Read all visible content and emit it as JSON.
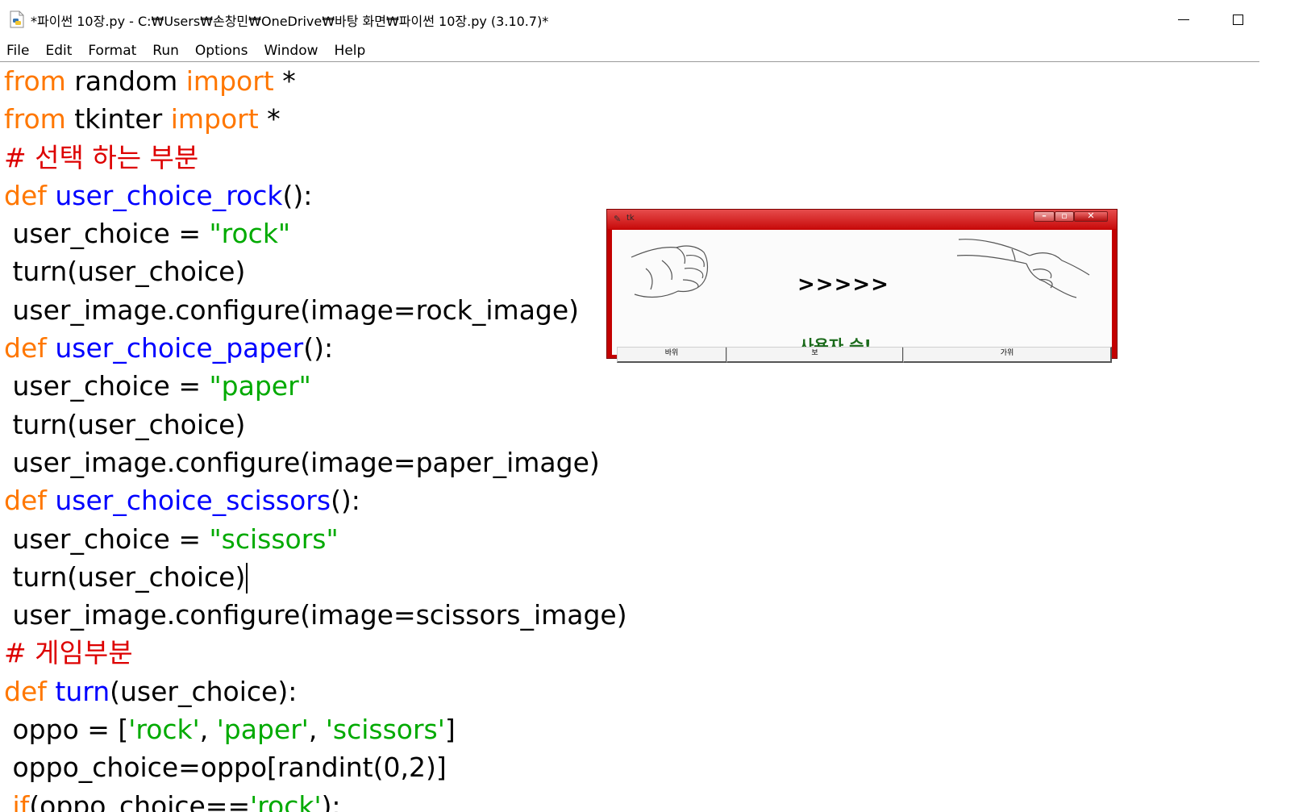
{
  "window": {
    "title": "*파이썬 10장.py - C:₩Users₩손창민₩OneDrive₩바탕 화면₩파이썬 10장.py (3.10.7)*"
  },
  "menu": {
    "items": [
      "File",
      "Edit",
      "Format",
      "Run",
      "Options",
      "Window",
      "Help"
    ]
  },
  "code": {
    "lines": [
      [
        [
          "kw",
          "from"
        ],
        [
          "pl",
          " random "
        ],
        [
          "kw",
          "import"
        ],
        [
          "pl",
          " *"
        ]
      ],
      [
        [
          "kw",
          "from"
        ],
        [
          "pl",
          " tkinter "
        ],
        [
          "kw",
          "import"
        ],
        [
          "pl",
          " *"
        ]
      ],
      [
        [
          "com",
          "# 선택 하는 부분"
        ]
      ],
      [
        [
          "kw",
          "def"
        ],
        [
          "pl",
          " "
        ],
        [
          "def",
          "user_choice_rock"
        ],
        [
          "pl",
          "():"
        ]
      ],
      [
        [
          "pl",
          " user_choice = "
        ],
        [
          "str",
          "\"rock\""
        ]
      ],
      [
        [
          "pl",
          " turn(user_choice)"
        ]
      ],
      [
        [
          "pl",
          " user_image.configure(image=rock_image)"
        ]
      ],
      [
        [
          "kw",
          "def"
        ],
        [
          "pl",
          " "
        ],
        [
          "def",
          "user_choice_paper"
        ],
        [
          "pl",
          "():"
        ]
      ],
      [
        [
          "pl",
          " user_choice = "
        ],
        [
          "str",
          "\"paper\""
        ]
      ],
      [
        [
          "pl",
          " turn(user_choice)"
        ]
      ],
      [
        [
          "pl",
          " user_image.configure(image=paper_image)"
        ]
      ],
      [
        [
          "kw",
          "def"
        ],
        [
          "pl",
          " "
        ],
        [
          "def",
          "user_choice_scissors"
        ],
        [
          "pl",
          "():"
        ]
      ],
      [
        [
          "pl",
          " user_choice = "
        ],
        [
          "str",
          "\"scissors\""
        ]
      ],
      [
        [
          "pl",
          " turn(user_choice)"
        ],
        [
          "caret",
          ""
        ]
      ],
      [
        [
          "pl",
          " user_image.configure(image=scissors_image)"
        ]
      ],
      [
        [
          "com",
          "# 게임부분"
        ]
      ],
      [
        [
          "kw",
          "def"
        ],
        [
          "pl",
          " "
        ],
        [
          "def",
          "turn"
        ],
        [
          "pl",
          "(user_choice):"
        ]
      ],
      [
        [
          "pl",
          " oppo = ["
        ],
        [
          "str",
          "'rock'"
        ],
        [
          "pl",
          ", "
        ],
        [
          "str",
          "'paper'"
        ],
        [
          "pl",
          ", "
        ],
        [
          "str",
          "'scissors'"
        ],
        [
          "pl",
          "]"
        ]
      ],
      [
        [
          "pl",
          " oppo_choice=oppo[randint(0,2)]"
        ]
      ],
      [
        [
          "pl",
          " "
        ],
        [
          "kw",
          "if"
        ],
        [
          "pl",
          "(oppo_choice=="
        ],
        [
          "str",
          "'rock'"
        ],
        [
          "pl",
          "):"
        ]
      ]
    ]
  },
  "colors": {
    "keyword": "#ff7700",
    "definition": "#0000ff",
    "string": "#00aa00",
    "comment": "#dd0000"
  },
  "tk_window": {
    "title": "tk",
    "arrows": ">>>>>",
    "result": "사용자 승!",
    "buttons": {
      "rock": "바위",
      "paper": "보",
      "scissors": "가위"
    },
    "left_image_icon": "fist-hand",
    "right_image_icon": "scissors-hand"
  }
}
